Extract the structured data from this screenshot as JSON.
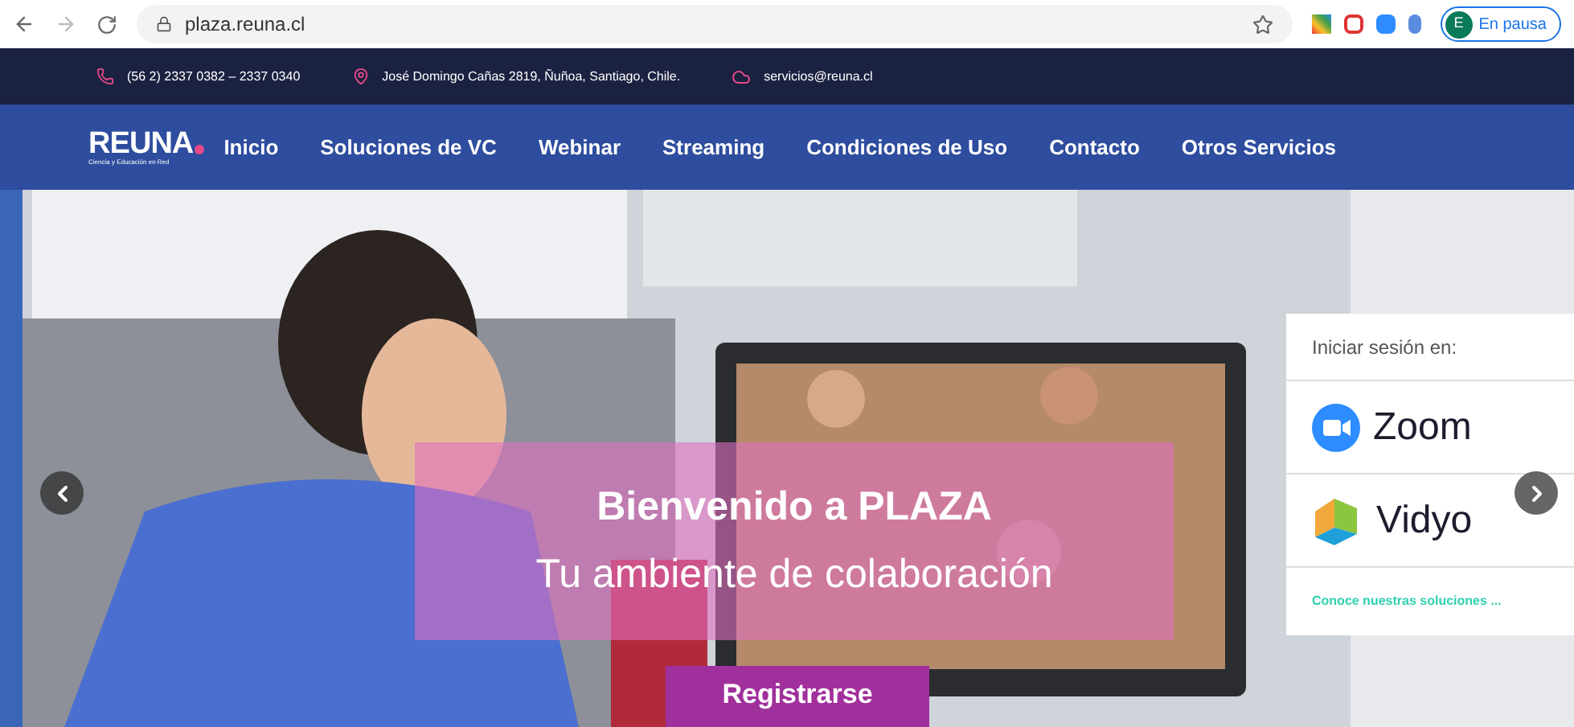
{
  "browser": {
    "url": "plaza.reuna.cl",
    "profile_initial": "E",
    "profile_status": "En pausa"
  },
  "contact_bar": {
    "phone": "(56 2) 2337 0382 – 2337 0340",
    "address": "José Domingo Cañas 2819, Ñuñoa, Santiago, Chile.",
    "email": "servicios@reuna.cl"
  },
  "nav": {
    "logo": "REUNA",
    "logo_tagline": "Ciencia y Educación en Red",
    "items": [
      {
        "label": "Inicio",
        "selected": false
      },
      {
        "label": "Soluciones de VC",
        "selected": false
      },
      {
        "label": "Webinar",
        "selected": false
      },
      {
        "label": "Streaming",
        "selected": false
      },
      {
        "label": "Condiciones de Uso",
        "selected": false
      },
      {
        "label": "Contacto",
        "selected": false
      },
      {
        "label": "Otros Servicios",
        "selected": false
      }
    ]
  },
  "hero": {
    "kind": "picture",
    "title": "Bienvenido a PLAZA",
    "subtitle": "Tu ambiente de colaboración",
    "button": "Registrarse"
  },
  "login_card": {
    "heading": "Iniciar sesión en:",
    "services": [
      {
        "name": "Zoom",
        "kind": "zoom"
      },
      {
        "name": "Vidyo",
        "kind": "vidyo"
      }
    ],
    "link": "Conoce nuestras soluciones ..."
  }
}
